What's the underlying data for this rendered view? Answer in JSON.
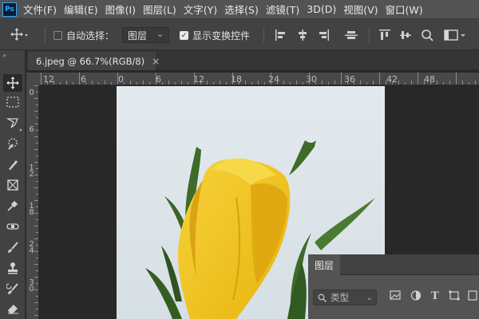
{
  "app": {
    "logo": "Ps"
  },
  "menu": [
    "文件(F)",
    "编辑(E)",
    "图像(I)",
    "图层(L)",
    "文字(Y)",
    "选择(S)",
    "滤镜(T)",
    "3D(D)",
    "视图(V)",
    "窗口(W)"
  ],
  "options_bar": {
    "auto_select_label": "自动选择：",
    "auto_select_checked": false,
    "auto_select_target": "图层",
    "show_transform_label": "显示变换控件",
    "show_transform_checked": true,
    "select_arrow": "⌄"
  },
  "toolbox": {
    "collapse": "»",
    "tools": [
      "move-tool",
      "marquee-tool",
      "lasso-tool",
      "quick-select-tool",
      "crop-tool",
      "frame-tool",
      "eyedropper-tool",
      "healing-brush-tool",
      "brush-tool",
      "clone-stamp-tool",
      "history-brush-tool",
      "eraser-tool"
    ]
  },
  "document": {
    "tab_title": "6.jpeg @ 66.7%(RGB/8)",
    "close": "×"
  },
  "ruler": {
    "h_labels": [
      "12",
      "6",
      "0",
      "6",
      "12",
      "18",
      "24",
      "30",
      "36",
      "42",
      "48"
    ],
    "v_labels": [
      "0",
      "6",
      "12",
      "18",
      "24",
      "30"
    ]
  },
  "layers_panel": {
    "tab": "图层",
    "filter_placeholder": "类型",
    "filter_icons": [
      "image-filter-icon",
      "adjustment-filter-icon",
      "type-filter-icon",
      "shape-filter-icon",
      "smart-object-filter-icon"
    ]
  },
  "colors": {
    "sky": "#dfe7ec",
    "petal": "#f2c418",
    "leaf": "#3e6a2a",
    "interface": "#535353"
  }
}
